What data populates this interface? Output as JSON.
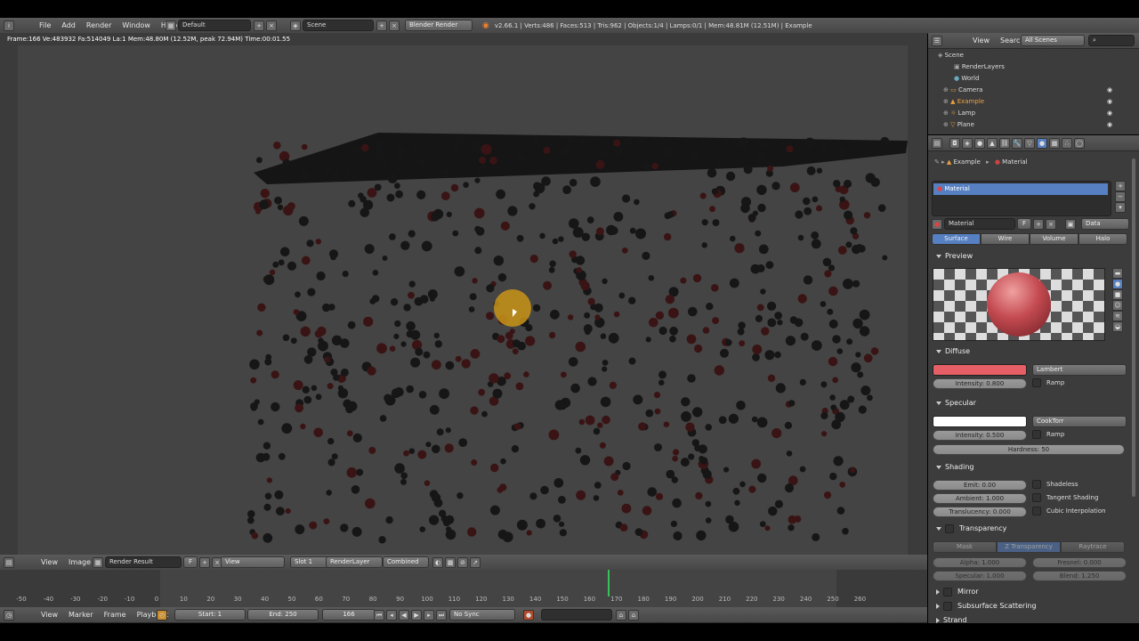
{
  "info_header": {
    "menus": [
      "File",
      "Add",
      "Render",
      "Window",
      "Help"
    ],
    "screen_layout": "Default",
    "scene": "Scene",
    "engine": "Blender Render",
    "stats": "v2.66.1 | Verts:486 | Faces:513 | Tris:962 | Objects:1/4 | Lamps:0/1 | Mem:48.81M (12.51M) | Example"
  },
  "render_view": {
    "status": "Frame:166 Ve:483932 Fa:514049 La:1 Mem:48.80M (12.52M, peak 72.94M) Time:00:01.55"
  },
  "image_header": {
    "menus": [
      "View",
      "Image"
    ],
    "image_name": "Render Result",
    "image_flag": "F",
    "view": "View",
    "slot": "Slot 1",
    "layer": "RenderLayer",
    "pass": "Combined"
  },
  "timeline": {
    "ticks": [
      "-50",
      "-40",
      "-30",
      "-20",
      "-10",
      "0",
      "10",
      "20",
      "30",
      "40",
      "50",
      "60",
      "70",
      "80",
      "90",
      "100",
      "110",
      "120",
      "130",
      "140",
      "150",
      "160",
      "170",
      "180",
      "190",
      "200",
      "210",
      "220",
      "230",
      "240",
      "250",
      "260"
    ],
    "menus": [
      "View",
      "Marker",
      "Frame",
      "Playback"
    ],
    "start": "Start: 1",
    "end": "End: 250",
    "current": "166",
    "sync": "No Sync"
  },
  "outliner": {
    "header": [
      "View",
      "Search"
    ],
    "filter": "All Scenes",
    "items": [
      "Scene",
      "RenderLayers",
      "World",
      "Camera",
      "Example",
      "Lamp",
      "Plane"
    ]
  },
  "properties": {
    "breadcrumb": [
      "Example",
      "Material"
    ],
    "slot_name": "Material",
    "material_field": "Material",
    "material_flag": "F",
    "link": "Data",
    "tabs": [
      "Surface",
      "Wire",
      "Volume",
      "Halo"
    ],
    "preview": {
      "label": "Preview"
    },
    "diffuse": {
      "label": "Diffuse",
      "color": "#e65f66",
      "shader": "Lambert",
      "intensity": "Intensity: 0.800",
      "ramp": "Ramp"
    },
    "specular": {
      "label": "Specular",
      "color": "#ffffff",
      "shader": "CookTorr",
      "intensity": "Intensity: 0.500",
      "ramp": "Ramp",
      "hardness": "Hardness: 50"
    },
    "shading": {
      "label": "Shading",
      "emit": "Emit: 0.00",
      "ambient": "Ambient: 1.000",
      "translucency": "Translucency: 0.000",
      "shadeless": "Shadeless",
      "tangent": "Tangent Shading",
      "cubic": "Cubic Interpolation"
    },
    "transparency": {
      "label": "Transparency",
      "modes": [
        "Mask",
        "Z Transparency",
        "Raytrace"
      ],
      "alpha": "Alpha: 1.000",
      "fresnel": "Fresnel: 0.000",
      "specular": "Specular: 1.000",
      "blend": "Blend: 1.250"
    },
    "mirror": "Mirror",
    "sss": "Subsurface Scattering",
    "strand": "Strand"
  }
}
